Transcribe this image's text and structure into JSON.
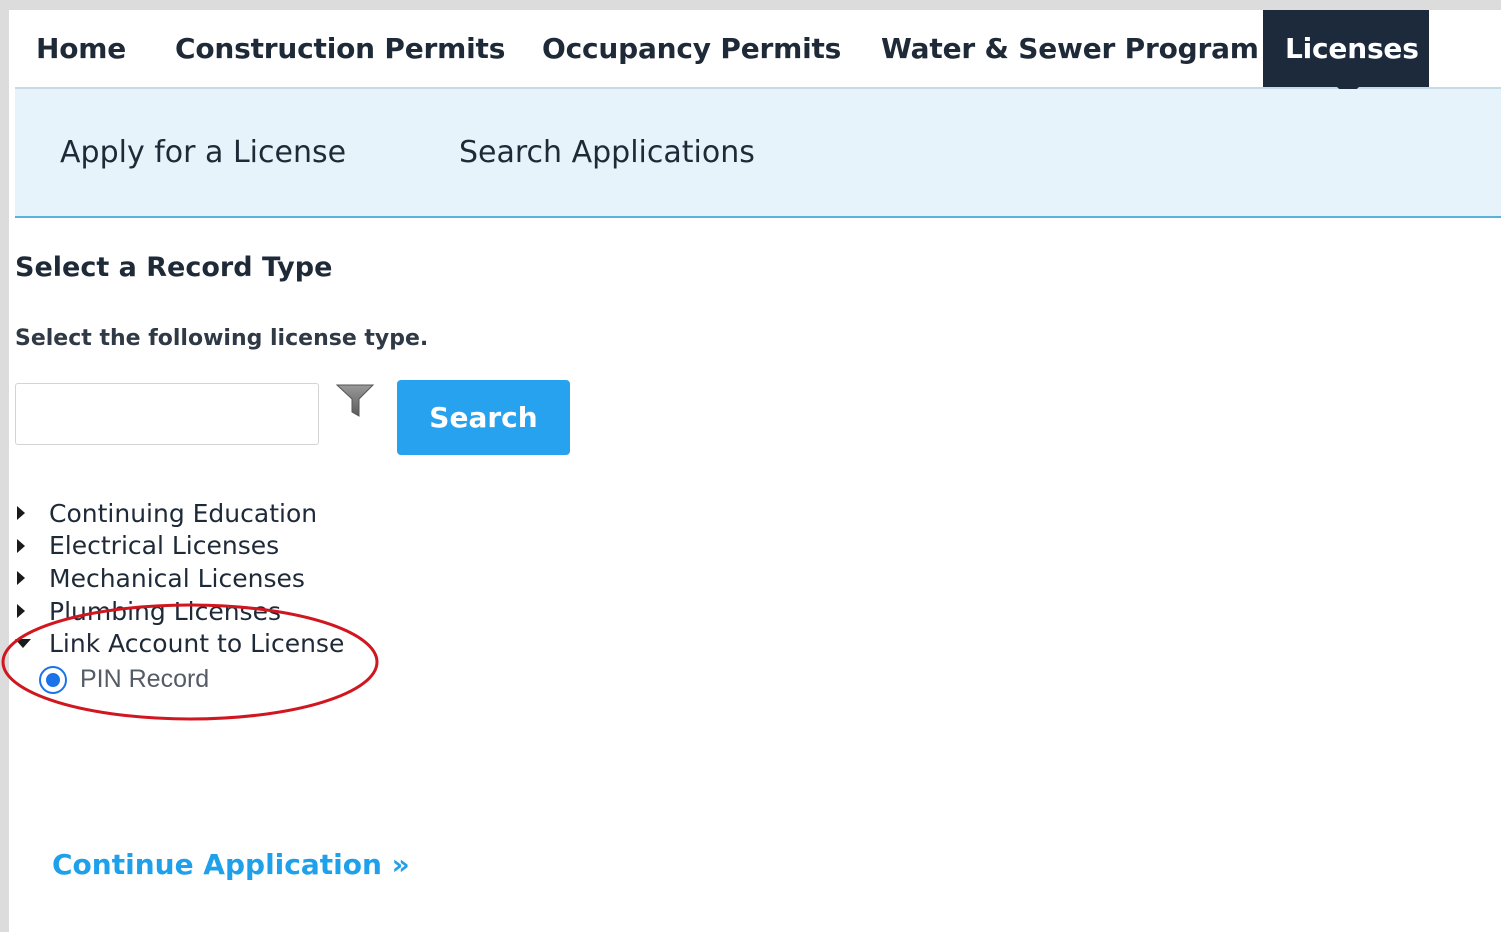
{
  "topnav": {
    "tabs": [
      {
        "label": "Home"
      },
      {
        "label": "Construction Permits"
      },
      {
        "label": "Occupancy Permits"
      },
      {
        "label": "Water & Sewer Program"
      },
      {
        "label": "Licenses",
        "active": true
      }
    ]
  },
  "subnav": {
    "links": [
      {
        "label": "Apply for a License"
      },
      {
        "label": "Search Applications"
      }
    ]
  },
  "page": {
    "heading": "Select a Record Type",
    "instruction": "Select the following license type."
  },
  "search": {
    "value": "",
    "placeholder": "",
    "button_label": "Search",
    "filter_icon": "filter-icon"
  },
  "tree": {
    "items": [
      {
        "label": "Continuing Education",
        "expanded": false
      },
      {
        "label": "Electrical Licenses",
        "expanded": false
      },
      {
        "label": "Mechanical Licenses",
        "expanded": false
      },
      {
        "label": "Plumbing Licenses",
        "expanded": false
      },
      {
        "label": "Link Account to License",
        "expanded": true
      }
    ],
    "options": [
      {
        "label": "PIN Record",
        "selected": true
      }
    ]
  },
  "actions": {
    "continue_label": "Continue Application »"
  },
  "colors": {
    "nav_active_bg": "#1d2a3c",
    "subnav_bg": "#e7f3fa",
    "subnav_border": "#5bb0dc",
    "button_bg": "#27a2ef",
    "link": "#1ea0ea",
    "annotation": "#d0161f",
    "radio": "#1a73e8"
  }
}
